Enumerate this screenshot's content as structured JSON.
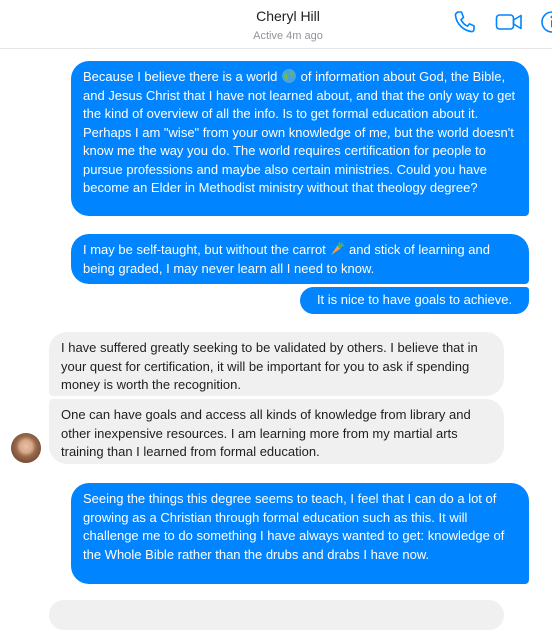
{
  "header": {
    "contact_name": "Cheryl Hill",
    "status": "Active 4m ago",
    "icons": [
      "phone-icon",
      "video-camera-icon",
      "info-icon"
    ],
    "accent_color": "#0084ff"
  },
  "messages": [
    {
      "from": "me",
      "text_before": "Because I believe there is a world ",
      "emoji": "globe-emoji",
      "text_after": " of information about God, the Bible, and Jesus Christ that I have not learned about, and that the only way to get the kind of overview of all the info. Is to get formal education about it.  Perhaps I am \"wise\" from your own knowledge of me, but the world doesn't know me the way you do.  The world requires certification for people to pursue professions and maybe also certain ministries.  Could you have become an Elder in Methodist ministry without that theology degree?"
    },
    {
      "from": "me",
      "text_before": "I may be self-taught, but without the carrot ",
      "emoji": "carrot-emoji",
      "text_after": " and stick of learning and being graded, I may never learn all I need to know."
    },
    {
      "from": "me",
      "text": "It is nice to have goals to achieve."
    },
    {
      "from": "them",
      "text": "I have suffered greatly seeking to be validated by others.  I believe that in your quest for certification, it will be important for you to ask if spending money is worth the recognition."
    },
    {
      "from": "them",
      "text": "One can have goals and access all kinds of knowledge from library and other inexpensive resources.  I am learning more from my martial arts training than I learned from formal education."
    },
    {
      "from": "me",
      "text": "Seeing the things this degree seems to teach, I feel that I can do a lot of growing as a Christian through formal education such as this.  It will challenge me to do something I have always wanted to get: knowledge of the Whole Bible rather than the drubs and drabs I have now."
    },
    {
      "from": "them",
      "text": ""
    }
  ]
}
